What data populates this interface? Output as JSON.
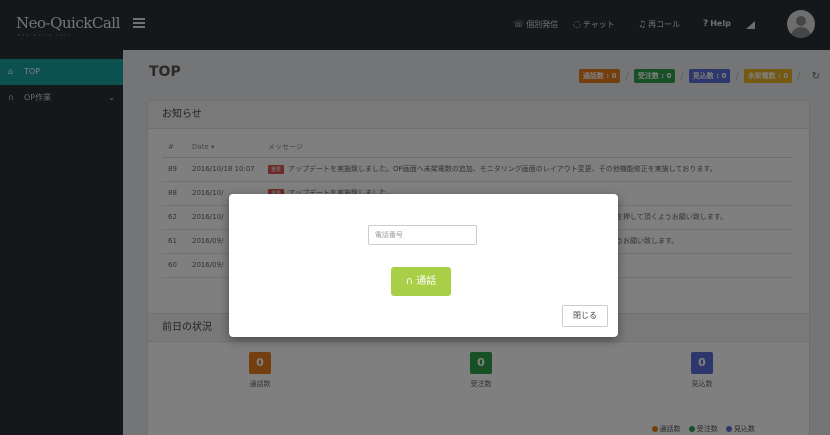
{
  "app": {
    "logo": "Neo-QuickCall",
    "logo_sub": "NEO-QUICK CALL"
  },
  "topnav": [
    {
      "icon": "☏",
      "label": "個別発信"
    },
    {
      "icon": "◌",
      "label": "チャット"
    },
    {
      "icon": "♫",
      "label": "再コール"
    },
    {
      "icon": "?",
      "label": "Help"
    }
  ],
  "sidebar": {
    "items": [
      {
        "icon": "⌂",
        "label": "TOP"
      },
      {
        "icon": "∩",
        "label": "OP作業"
      }
    ]
  },
  "page": {
    "title": "TOP"
  },
  "counters": [
    {
      "label": "通話数 : 0",
      "color": "#e87d1e"
    },
    {
      "label": "受注数 : 0",
      "color": "#2fa04a"
    },
    {
      "label": "見込数 : 0",
      "color": "#5b6fd6"
    },
    {
      "label": "未架電数 : 0",
      "color": "#e7b31f"
    }
  ],
  "notice": {
    "title": "お知らせ",
    "columns": [
      "#",
      "Date ▾",
      "メッセージ"
    ],
    "rows": [
      {
        "id": "89",
        "date": "2016/10/18 10:07",
        "badge": "重要",
        "message": "アップデートを実施致しました。OP画面へ未架電数の追加、モニタリング画面のレイアウト変更、その他機能修正を実施しております。"
      },
      {
        "id": "88",
        "date": "2016/10/",
        "badge": "重要",
        "message": "アップデートを実施致しました。"
      },
      {
        "id": "62",
        "date": "2016/10/",
        "badge": "",
        "message": "タンを押して頂くようお願い致します。"
      },
      {
        "id": "61",
        "date": "2016/09/",
        "badge": "",
        "message": "くようお願い致します。"
      },
      {
        "id": "60",
        "date": "2016/09/",
        "badge": "",
        "message": "さい。"
      }
    ]
  },
  "yesterday": {
    "title": "前日の状況",
    "stats": [
      {
        "value": "0",
        "label": "通話数",
        "color": "#e87d1e"
      },
      {
        "value": "0",
        "label": "受注数",
        "color": "#2fa04a"
      },
      {
        "value": "0",
        "label": "見込数",
        "color": "#5b6fd6"
      }
    ],
    "legend": [
      {
        "label": "通話数",
        "color": "#e87d1e"
      },
      {
        "label": "受注数",
        "color": "#2fa04a"
      },
      {
        "label": "見込数",
        "color": "#5b6fd6"
      }
    ]
  },
  "modal": {
    "phone_placeholder": "電話番号",
    "call_label": "通話",
    "close_label": "閉じる"
  }
}
